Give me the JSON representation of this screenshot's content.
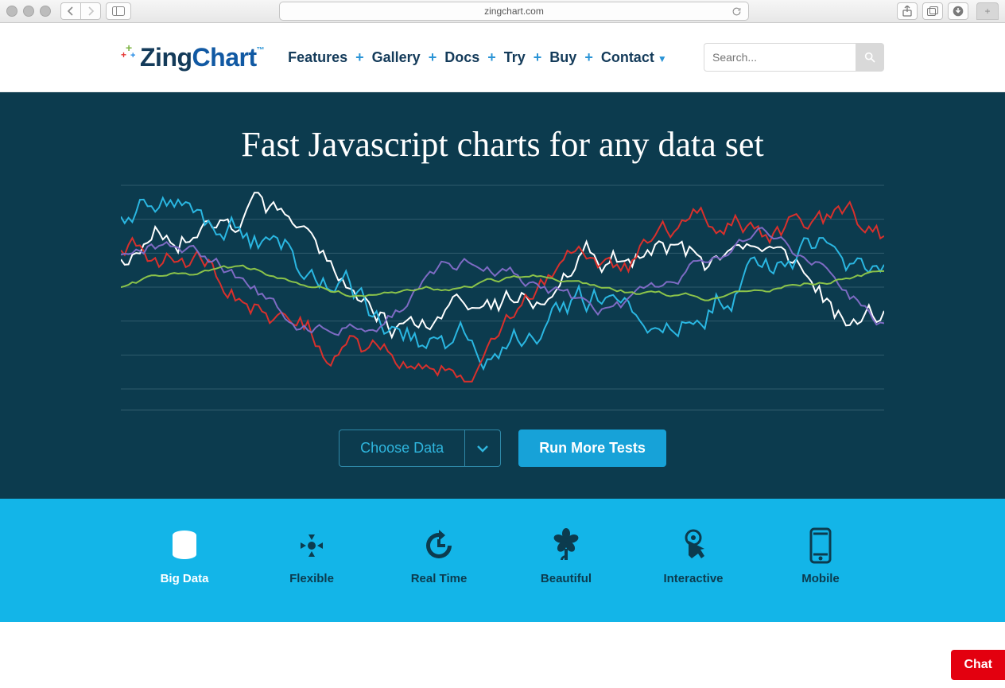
{
  "browser": {
    "url": "zingchart.com"
  },
  "logo": {
    "part1": "Zing",
    "part2": "Chart",
    "tm": "™"
  },
  "nav": {
    "items": [
      "Features",
      "Gallery",
      "Docs",
      "Try",
      "Buy",
      "Contact"
    ]
  },
  "search": {
    "placeholder": "Search..."
  },
  "hero": {
    "headline": "Fast Javascript charts for any data set",
    "choose_label": "Choose Data",
    "run_label": "Run More Tests"
  },
  "features": {
    "items": [
      {
        "id": "big-data",
        "label": "Big Data",
        "selected": true
      },
      {
        "id": "flexible",
        "label": "Flexible",
        "selected": false
      },
      {
        "id": "real-time",
        "label": "Real Time",
        "selected": false
      },
      {
        "id": "beautiful",
        "label": "Beautiful",
        "selected": false
      },
      {
        "id": "interactive",
        "label": "Interactive",
        "selected": false
      },
      {
        "id": "mobile",
        "label": "Mobile",
        "selected": false
      }
    ]
  },
  "chat": {
    "label": "Chat"
  },
  "chart_data": {
    "type": "line",
    "x": {
      "range": [
        0,
        100
      ],
      "gridlines": 0
    },
    "y": {
      "range": [
        -1.2,
        1.2
      ],
      "gridlines": 7
    },
    "series": [
      {
        "name": "white",
        "color": "#ffffff",
        "amp": 1.0,
        "freq": 0.55,
        "phase": 0.2,
        "noise": 0.3
      },
      {
        "name": "cyan",
        "color": "#2ab7e2",
        "amp": 0.95,
        "freq": 0.4,
        "phase": 1.1,
        "noise": 0.35
      },
      {
        "name": "red",
        "color": "#d9302c",
        "amp": 0.95,
        "freq": 0.35,
        "phase": 2.0,
        "noise": 0.3
      },
      {
        "name": "purple",
        "color": "#7e6bc4",
        "amp": 0.55,
        "freq": 0.8,
        "phase": 0.6,
        "noise": 0.15
      },
      {
        "name": "green",
        "color": "#8bc34a",
        "amp": 0.2,
        "freq": 0.7,
        "phase": 0.0,
        "noise": 0.05
      }
    ]
  }
}
